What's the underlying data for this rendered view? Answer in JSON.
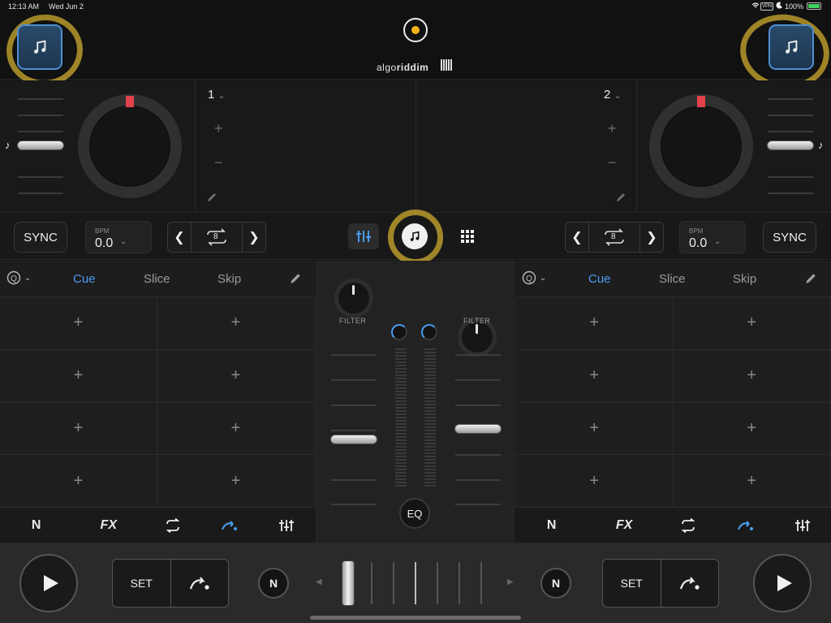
{
  "status_bar": {
    "time": "12:13 AM",
    "date": "Wed Jun 2",
    "battery": "100%",
    "vpn": "VPN"
  },
  "top_bar": {
    "brand_light": "algo",
    "brand_bold": "riddim"
  },
  "decks": {
    "left": {
      "number": "1"
    },
    "right": {
      "number": "2"
    }
  },
  "transport": {
    "left": {
      "sync": "SYNC",
      "bpm_label": "BPM",
      "bpm_value": "0.0",
      "loop_size": "8"
    },
    "right": {
      "sync": "SYNC",
      "bpm_label": "BPM",
      "bpm_value": "0.0",
      "loop_size": "8"
    }
  },
  "pads": {
    "left": {
      "tabs": [
        "Cue",
        "Slice",
        "Skip"
      ],
      "active_tab": "Cue"
    },
    "right": {
      "tabs": [
        "Cue",
        "Slice",
        "Skip"
      ],
      "active_tab": "Cue"
    },
    "pad_symbol": "+"
  },
  "footer_icons": {
    "fx": "FX",
    "neural": "N"
  },
  "mixer": {
    "filter_label": "FILTER",
    "eq_label": "EQ"
  },
  "bottom": {
    "set_label": "SET"
  },
  "colors": {
    "accent": "#4a9cf0",
    "record": "#f5b21b",
    "platter_marker": "#e2424b",
    "highlight": "#d6b230"
  }
}
